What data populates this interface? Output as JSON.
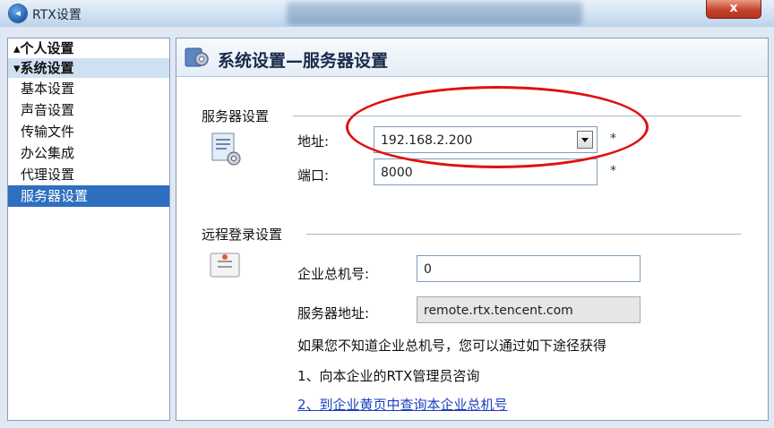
{
  "window": {
    "title": "RTX设置",
    "close_label": "x"
  },
  "sidebar": {
    "groups": [
      {
        "label": "▴个人设置"
      },
      {
        "label": "▾系统设置"
      }
    ],
    "items": [
      {
        "label": "基本设置"
      },
      {
        "label": "声音设置"
      },
      {
        "label": "传输文件"
      },
      {
        "label": "办公集成"
      },
      {
        "label": "代理设置"
      },
      {
        "label": "服务器设置",
        "active": true
      }
    ]
  },
  "main": {
    "title": "系统设置—服务器设置",
    "server_section": {
      "label": "服务器设置",
      "address_label": "地址:",
      "address_value": "192.168.2.200",
      "port_label": "端口:",
      "port_value": "8000",
      "required_mark": "*"
    },
    "remote_section": {
      "label": "远程登录设置",
      "company_label": "企业总机号:",
      "company_value": "0",
      "server_addr_label": "服务器地址:",
      "server_addr_value": "remote.rtx.tencent.com",
      "hint": "如果您不知道企业总机号，您可以通过如下途径获得",
      "step1": "1、向本企业的RTX管理员咨询",
      "step2": "2、到企业黄页中查询本企业总机号"
    }
  },
  "colors": {
    "highlight_ellipse": "#e01010",
    "active_item": "#2f6fc0",
    "link": "#1a3fc0"
  }
}
